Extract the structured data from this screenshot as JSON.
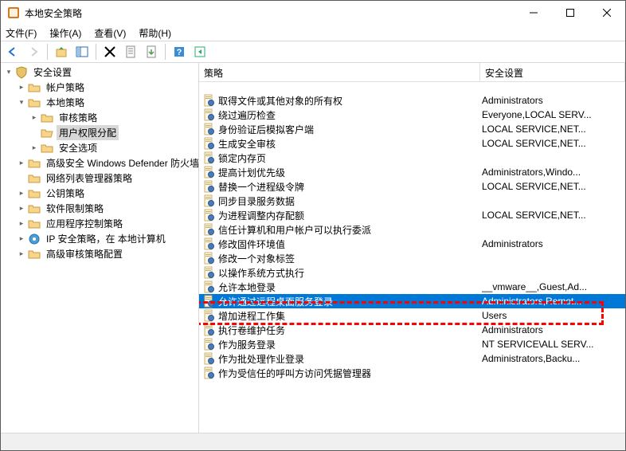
{
  "window": {
    "title": "本地安全策略"
  },
  "menu": {
    "file": "文件(F)",
    "action": "操作(A)",
    "view": "查看(V)",
    "help": "帮助(H)"
  },
  "tree": [
    {
      "level": 1,
      "exp": "▾",
      "icon": "shield",
      "label": "安全设置",
      "sel": false
    },
    {
      "level": 2,
      "exp": "▸",
      "icon": "folder",
      "label": "帐户策略",
      "sel": false
    },
    {
      "level": 2,
      "exp": "▾",
      "icon": "folder",
      "label": "本地策略",
      "sel": false
    },
    {
      "level": 3,
      "exp": "▸",
      "icon": "folder",
      "label": "审核策略",
      "sel": false
    },
    {
      "level": 3,
      "exp": "",
      "icon": "folder-open",
      "label": "用户权限分配",
      "sel": true
    },
    {
      "level": 3,
      "exp": "▸",
      "icon": "folder",
      "label": "安全选项",
      "sel": false
    },
    {
      "level": 2,
      "exp": "▸",
      "icon": "folder",
      "label": "高级安全 Windows Defender 防火墙",
      "sel": false
    },
    {
      "level": 2,
      "exp": "",
      "icon": "folder",
      "label": "网络列表管理器策略",
      "sel": false
    },
    {
      "level": 2,
      "exp": "▸",
      "icon": "folder",
      "label": "公钥策略",
      "sel": false
    },
    {
      "level": 2,
      "exp": "▸",
      "icon": "folder",
      "label": "软件限制策略",
      "sel": false
    },
    {
      "level": 2,
      "exp": "▸",
      "icon": "folder",
      "label": "应用程序控制策略",
      "sel": false
    },
    {
      "level": 2,
      "exp": "▸",
      "icon": "ip",
      "label": "IP 安全策略，在 本地计算机",
      "sel": false
    },
    {
      "level": 2,
      "exp": "▸",
      "icon": "folder",
      "label": "高级审核策略配置",
      "sel": false
    }
  ],
  "columns": {
    "policy": "策略",
    "setting": "安全设置"
  },
  "rows": [
    {
      "name": "取得文件或其他对象的所有权",
      "setting": "Administrators",
      "sel": false
    },
    {
      "name": "绕过遍历检查",
      "setting": "Everyone,LOCAL SERV...",
      "sel": false
    },
    {
      "name": "身份验证后模拟客户端",
      "setting": "LOCAL SERVICE,NET...",
      "sel": false
    },
    {
      "name": "生成安全审核",
      "setting": "LOCAL SERVICE,NET...",
      "sel": false
    },
    {
      "name": "锁定内存页",
      "setting": "",
      "sel": false
    },
    {
      "name": "提高计划优先级",
      "setting": "Administrators,Windo...",
      "sel": false
    },
    {
      "name": "替换一个进程级令牌",
      "setting": "LOCAL SERVICE,NET...",
      "sel": false
    },
    {
      "name": "同步目录服务数据",
      "setting": "",
      "sel": false
    },
    {
      "name": "为进程调整内存配额",
      "setting": "LOCAL SERVICE,NET...",
      "sel": false
    },
    {
      "name": "信任计算机和用户帐户可以执行委派",
      "setting": "",
      "sel": false
    },
    {
      "name": "修改固件环境值",
      "setting": "Administrators",
      "sel": false
    },
    {
      "name": "修改一个对象标签",
      "setting": "",
      "sel": false
    },
    {
      "name": "以操作系统方式执行",
      "setting": "",
      "sel": false
    },
    {
      "name": "允许本地登录",
      "setting": "__vmware__,Guest,Ad...",
      "sel": false
    },
    {
      "name": "允许通过远程桌面服务登录",
      "setting": "Administrators,Remot...",
      "sel": true
    },
    {
      "name": "增加进程工作集",
      "setting": "Users",
      "sel": false
    },
    {
      "name": "执行卷维护任务",
      "setting": "Administrators",
      "sel": false
    },
    {
      "name": "作为服务登录",
      "setting": "NT SERVICE\\ALL SERV...",
      "sel": false
    },
    {
      "name": "作为批处理作业登录",
      "setting": "Administrators,Backu...",
      "sel": false
    },
    {
      "name": "作为受信任的呼叫方访问凭据管理器",
      "setting": "",
      "sel": false
    }
  ]
}
